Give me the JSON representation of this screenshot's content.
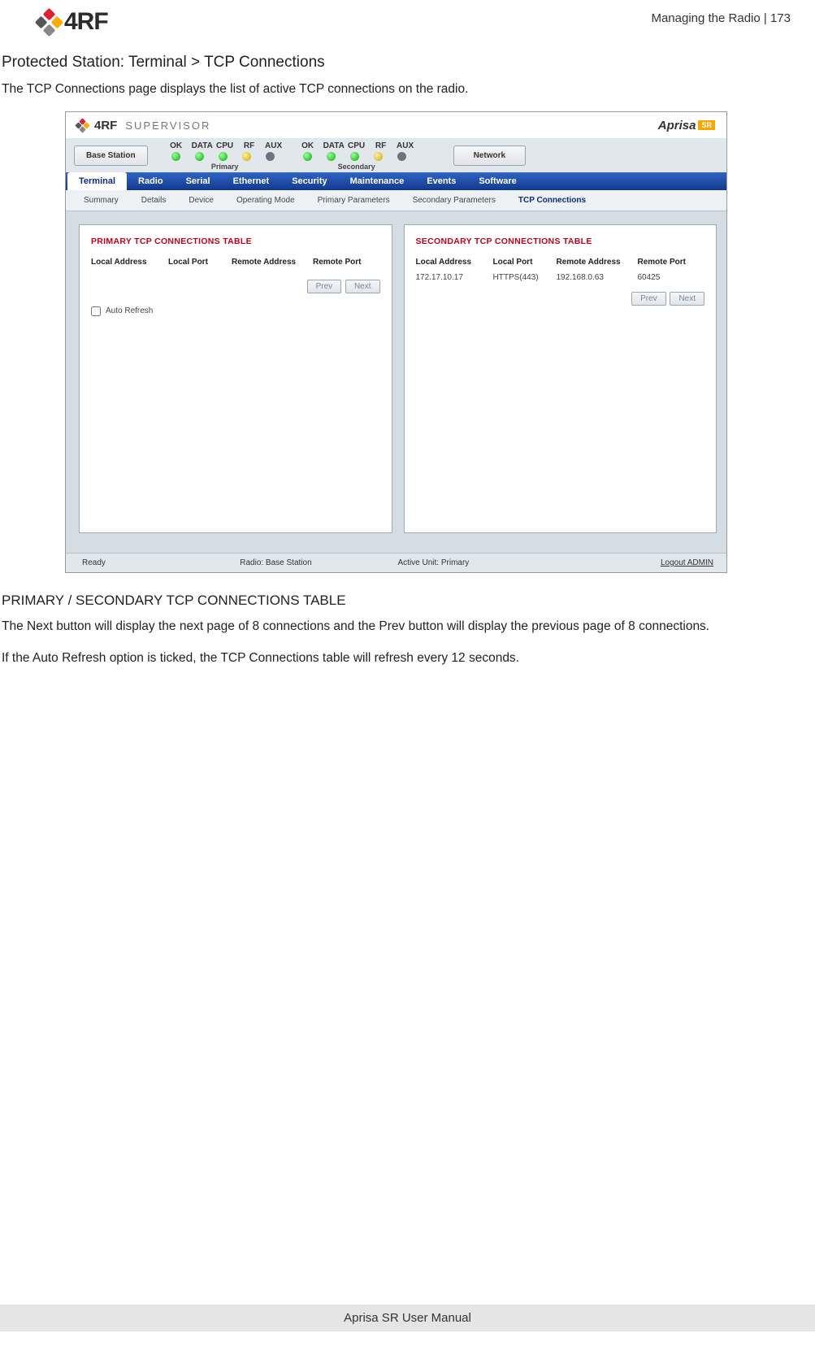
{
  "page_header": {
    "logo_text": "4RF",
    "right": "Managing the Radio  |  173"
  },
  "doc": {
    "title": "Protected Station: Terminal > TCP Connections",
    "intro": "The TCP Connections page displays the list of active TCP connections on the radio.",
    "subhead": "PRIMARY / SECONDARY TCP CONNECTIONS TABLE",
    "para1": "The Next button will display the next page of 8 connections and the Prev button will display the previous page of 8 connections.",
    "para2": "If the Auto Refresh option is ticked, the TCP Connections table will refresh every 12 seconds."
  },
  "shot": {
    "supervisor": {
      "brand": "4RF",
      "title": "SUPERVISOR",
      "product": "Aprisa",
      "product_badge": "SR"
    },
    "station_button": "Base Station",
    "led_headers": [
      "OK",
      "DATA",
      "CPU",
      "RF",
      "AUX"
    ],
    "led_primary_label": "Primary",
    "led_secondary_label": "Secondary",
    "network_button": "Network",
    "main_tabs": [
      "Terminal",
      "Radio",
      "Serial",
      "Ethernet",
      "Security",
      "Maintenance",
      "Events",
      "Software"
    ],
    "main_tabs_active": "Terminal",
    "sub_tabs": [
      "Summary",
      "Details",
      "Device",
      "Operating Mode",
      "Primary Parameters",
      "Secondary Parameters",
      "TCP Connections"
    ],
    "sub_tabs_active": "TCP Connections",
    "primary_table": {
      "title": "PRIMARY TCP CONNECTIONS TABLE",
      "cols": [
        "Local Address",
        "Local Port",
        "Remote Address",
        "Remote Port"
      ],
      "rows": [],
      "prev": "Prev",
      "next": "Next",
      "auto_refresh_label": "Auto Refresh"
    },
    "secondary_table": {
      "title": "SECONDARY TCP CONNECTIONS TABLE",
      "cols": [
        "Local Address",
        "Local Port",
        "Remote Address",
        "Remote Port"
      ],
      "rows": [
        {
          "la": "172.17.10.17",
          "lp": "HTTPS(443)",
          "ra": "192.168.0.63",
          "rp": "60425"
        }
      ],
      "prev": "Prev",
      "next": "Next"
    },
    "statusbar": {
      "ready": "Ready",
      "radio": "Radio: Base Station",
      "active": "Active Unit: Primary",
      "logout": "Logout ADMIN"
    }
  },
  "footer": "Aprisa SR User Manual"
}
